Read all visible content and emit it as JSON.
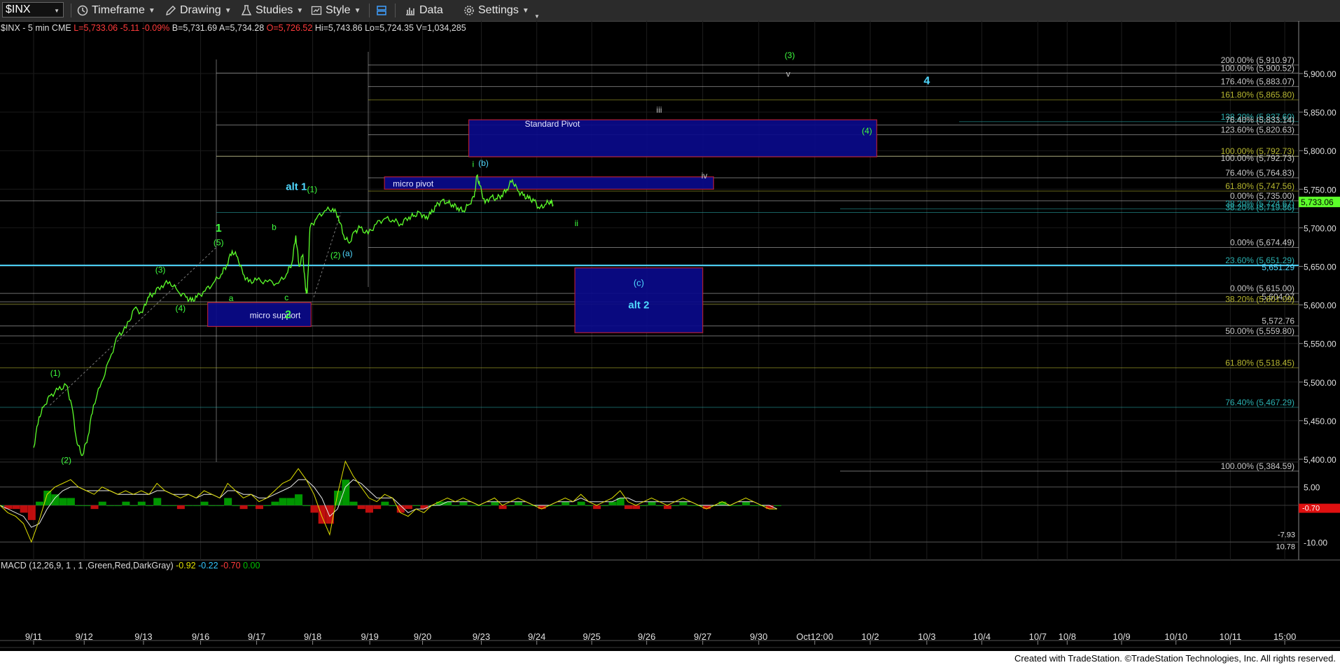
{
  "toolbar": {
    "symbol": "$INX",
    "timeframe": "Timeframe",
    "drawing": "Drawing",
    "studies": "Studies",
    "style": "Style",
    "data": "Data",
    "settings": "Settings"
  },
  "info": {
    "symbol_desc": "$INX - 5 min  CME",
    "last": "L=5,733.06",
    "chg": "-5.11",
    "pct": "-0.09%",
    "bid": "B=5,731.69",
    "ask": "A=5,734.28",
    "open": "O=5,726.52",
    "hi": "Hi=5,743.86",
    "lo": "Lo=5,724.35",
    "vol": "V=1,034,285"
  },
  "macd_info": {
    "name": "MACD (12,26,9, 1 , 1 ,Green,Red,DarkGray)",
    "macd": "-0.92",
    "signal": "-0.22",
    "hist": "-0.70",
    "zero": "0.00"
  },
  "footer": "Created with TradeStation. ©TradeStation Technologies, Inc. All rights reserved.",
  "colors": {
    "price_line": "#5cff2a",
    "accent_cyan": "#4fd8ff",
    "box_fill": "#0a0a8a",
    "box_border": "#c0203a",
    "label_green": "#3fff3f"
  },
  "chart_data": [
    {
      "type": "line",
      "symbol": "$INX",
      "interval": "5 min",
      "ylim": [
        5360,
        5945
      ],
      "y_ticks": [
        5400,
        5450,
        5500,
        5550,
        5600,
        5650,
        5700,
        5750,
        5800,
        5850,
        5900
      ],
      "y_tick_labels": [
        "5,400.00",
        "5,450.00",
        "5,500.00",
        "5,550.00",
        "5,600.00",
        "5,650.00",
        "5,700.00",
        "5,750.00",
        "5,800.00",
        "5,850.00",
        "5,900.00"
      ],
      "x_labels": [
        "9/11",
        "9/12",
        "9/13",
        "9/16",
        "9/17",
        "9/18",
        "9/19",
        "9/20",
        "9/23",
        "9/24",
        "9/25",
        "9/26",
        "9/27",
        "9/30",
        "Oct12:00",
        "10/2",
        "10/3",
        "10/4",
        "10/7",
        "10/8",
        "10/9",
        "10/10",
        "10/11",
        "15:00"
      ],
      "last_price": 5733.06,
      "last_price_label": "5,733.06",
      "series": [
        {
          "name": "$INX",
          "points": [
            [
              0.0,
              5415
            ],
            [
              0.1,
              5455
            ],
            [
              0.2,
              5470
            ],
            [
              0.3,
              5482
            ],
            [
              0.45,
              5490
            ],
            [
              0.6,
              5496
            ],
            [
              0.7,
              5470
            ],
            [
              0.8,
              5420
            ],
            [
              0.9,
              5405
            ],
            [
              1.0,
              5430
            ],
            [
              1.1,
              5470
            ],
            [
              1.25,
              5500
            ],
            [
              1.4,
              5530
            ],
            [
              1.55,
              5560
            ],
            [
              1.7,
              5570
            ],
            [
              1.85,
              5595
            ],
            [
              2.0,
              5590
            ],
            [
              2.1,
              5610
            ],
            [
              2.2,
              5615
            ],
            [
              2.35,
              5625
            ],
            [
              2.5,
              5630
            ],
            [
              2.65,
              5618
            ],
            [
              2.8,
              5610
            ],
            [
              2.9,
              5605
            ],
            [
              3.0,
              5610
            ],
            [
              3.15,
              5618
            ],
            [
              3.3,
              5628
            ],
            [
              3.45,
              5640
            ],
            [
              3.55,
              5652
            ],
            [
              3.65,
              5670
            ],
            [
              3.75,
              5662
            ],
            [
              3.85,
              5640
            ],
            [
              3.95,
              5630
            ],
            [
              4.1,
              5632
            ],
            [
              4.3,
              5630
            ],
            [
              4.5,
              5628
            ],
            [
              4.65,
              5640
            ],
            [
              4.75,
              5655
            ],
            [
              4.82,
              5690
            ],
            [
              4.88,
              5650
            ],
            [
              4.95,
              5665
            ],
            [
              5.0,
              5620
            ],
            [
              5.03,
              5615
            ],
            [
              5.08,
              5700
            ],
            [
              5.2,
              5712
            ],
            [
              5.35,
              5722
            ],
            [
              5.5,
              5725
            ],
            [
              5.6,
              5715
            ],
            [
              5.7,
              5690
            ],
            [
              5.8,
              5680
            ],
            [
              5.9,
              5695
            ],
            [
              6.0,
              5700
            ],
            [
              6.15,
              5692
            ],
            [
              6.3,
              5705
            ],
            [
              6.45,
              5712
            ],
            [
              6.6,
              5710
            ],
            [
              6.75,
              5705
            ],
            [
              6.9,
              5714
            ],
            [
              7.0,
              5716
            ],
            [
              7.1,
              5720
            ],
            [
              7.2,
              5712
            ],
            [
              7.3,
              5718
            ],
            [
              7.4,
              5728
            ],
            [
              7.5,
              5735
            ],
            [
              7.6,
              5733
            ],
            [
              7.7,
              5730
            ],
            [
              7.8,
              5726
            ],
            [
              7.9,
              5722
            ],
            [
              8.0,
              5730
            ],
            [
              8.1,
              5740
            ],
            [
              8.15,
              5768
            ],
            [
              8.2,
              5755
            ],
            [
              8.3,
              5732
            ],
            [
              8.4,
              5740
            ],
            [
              8.5,
              5738
            ],
            [
              8.6,
              5742
            ],
            [
              8.7,
              5750
            ],
            [
              8.8,
              5762
            ],
            [
              8.9,
              5748
            ],
            [
              9.0,
              5742
            ],
            [
              9.1,
              5738
            ],
            [
              9.2,
              5735
            ],
            [
              9.3,
              5725
            ],
            [
              9.4,
              5730
            ],
            [
              9.5,
              5735
            ],
            [
              9.55,
              5730
            ]
          ]
        }
      ],
      "fib_lines": [
        {
          "label": "200.00% (5,910.97)",
          "value": 5910.97,
          "color": "#c8c8c8"
        },
        {
          "label": "100.00% (5,900.52)",
          "value": 5900.52,
          "color": "#c8c8c8"
        },
        {
          "label": "176.40% (5,883.07)",
          "value": 5883.07,
          "color": "#c8c8c8"
        },
        {
          "label": "161.80% (5,865.80)",
          "value": 5865.8,
          "color": "#b8b830"
        },
        {
          "label": "138.20% (5,837.60)",
          "value": 5837.6,
          "color": "#2ab0b0"
        },
        {
          "label": "76.40% (5,833.14)",
          "value": 5833.14,
          "color": "#c8c8c8"
        },
        {
          "label": "123.60% (5,820.63)",
          "value": 5820.63,
          "color": "#c8c8c8"
        },
        {
          "label": "100.00% (5,792.73)",
          "value": 5792.73,
          "color": "#b8b830"
        },
        {
          "label": "100.00% (5,792.73)",
          "value": 5792.73,
          "color": "#c8c8c8"
        },
        {
          "label": "76.40% (5,764.83)",
          "value": 5764.83,
          "color": "#c8c8c8"
        },
        {
          "label": "61.80% (5,747.56)",
          "value": 5747.56,
          "color": "#b8b830"
        },
        {
          "label": "0.00% (5,735.00)",
          "value": 5735.0,
          "color": "#c8c8c8"
        },
        {
          "label": "38.20% (5,724.67)",
          "value": 5724.67,
          "color": "#2ab0b0"
        },
        {
          "label": "38.20% (5,719.86)",
          "value": 5719.86,
          "color": "#2ab0b0"
        },
        {
          "label": "0.00% (5,674.49)",
          "value": 5674.49,
          "color": "#c8c8c8"
        },
        {
          "label": "23.60% (5,651.29)",
          "value": 5651.29,
          "color": "#2ab0b0"
        },
        {
          "label": "5,651.29",
          "value": 5651.29,
          "color": "#4fd8ff"
        },
        {
          "label": "0.00% (5,615.00)",
          "value": 5615.0,
          "color": "#c8c8c8"
        },
        {
          "label": "5,604.07",
          "value": 5604.07,
          "color": "#c8c8c8"
        },
        {
          "label": "38.20% (5,601.09)",
          "value": 5601.09,
          "color": "#b8b830"
        },
        {
          "label": "5,572.76",
          "value": 5572.76,
          "color": "#c8c8c8"
        },
        {
          "label": "50.00% (5,559.80)",
          "value": 5559.8,
          "color": "#c8c8c8"
        },
        {
          "label": "61.80% (5,518.45)",
          "value": 5518.45,
          "color": "#b8b830"
        },
        {
          "label": "76.40% (5,467.29)",
          "value": 5467.29,
          "color": "#2ab0b0"
        },
        {
          "label": "100.00% (5,384.59)",
          "value": 5384.59,
          "color": "#c8c8c8"
        }
      ],
      "zones": [
        {
          "label": "Standard Pivot",
          "x": [
            8.0,
            15.5
          ],
          "y": [
            5792,
            5840
          ]
        },
        {
          "label": "micro pivot",
          "x": [
            6.45,
            12.5
          ],
          "y": [
            5750,
            5766
          ]
        },
        {
          "label": "micro support",
          "x": [
            3.2,
            5.1
          ],
          "y": [
            5572,
            5603
          ]
        },
        {
          "label": "(c)",
          "label2": "alt 2",
          "x": [
            9.95,
            12.3
          ],
          "y": [
            5564,
            5648
          ]
        }
      ],
      "annotations": [
        {
          "text": "(1)",
          "x": 0.4,
          "y": 5508,
          "color": "#3fff3f"
        },
        {
          "text": "(2)",
          "x": 0.6,
          "y": 5395,
          "color": "#3fff3f"
        },
        {
          "text": "(3)",
          "x": 2.33,
          "y": 5642,
          "color": "#3fff3f"
        },
        {
          "text": "(4)",
          "x": 2.7,
          "y": 5592,
          "color": "#3fff3f"
        },
        {
          "text": "1",
          "x": 3.4,
          "y": 5695,
          "color": "#3fff3f"
        },
        {
          "text": "(5)",
          "x": 3.4,
          "y": 5677,
          "color": "#3fff3f"
        },
        {
          "text": "a",
          "x": 3.63,
          "y": 5605,
          "color": "#3fff3f"
        },
        {
          "text": "b",
          "x": 4.42,
          "y": 5697,
          "color": "#3fff3f"
        },
        {
          "text": "c",
          "x": 4.65,
          "y": 5606,
          "color": "#3fff3f"
        },
        {
          "text": "2",
          "x": 4.68,
          "y": 5583,
          "color": "#3fff3f"
        },
        {
          "text": "alt 1",
          "x": 4.83,
          "y": 5749,
          "color": "#4fd8ff"
        },
        {
          "text": "(1)",
          "x": 5.12,
          "y": 5746,
          "color": "#3fff3f"
        },
        {
          "text": "(2)",
          "x": 5.55,
          "y": 5661,
          "color": "#3fff3f"
        },
        {
          "text": "(a)",
          "x": 5.77,
          "y": 5663,
          "color": "#4fd8ff"
        },
        {
          "text": "i",
          "x": 8.08,
          "y": 5779,
          "color": "#3fff3f"
        },
        {
          "text": "(b)",
          "x": 8.27,
          "y": 5780,
          "color": "#4fd8ff"
        },
        {
          "text": "ii",
          "x": 9.98,
          "y": 5702,
          "color": "#3fff3f"
        },
        {
          "text": "iii",
          "x": 11.5,
          "y": 5849,
          "color": "#c8c8c8"
        },
        {
          "text": "iv",
          "x": 12.33,
          "y": 5764,
          "color": "#c8c8c8"
        },
        {
          "text": "(3)",
          "x": 13.9,
          "y": 5920,
          "color": "#3fff3f"
        },
        {
          "text": "v",
          "x": 13.87,
          "y": 5896,
          "color": "#c8c8c8"
        },
        {
          "text": "(4)",
          "x": 15.32,
          "y": 5822,
          "color": "#3fff3f"
        },
        {
          "text": "4",
          "x": 16.42,
          "y": 5886,
          "color": "#4fd8ff"
        }
      ]
    },
    {
      "type": "line",
      "title": "MACD (12,26,9, 1 , 1 ,Green,Red,DarkGray)",
      "ylim": [
        -13,
        8
      ],
      "y_ticks": [
        5,
        -10
      ],
      "y_tick_labels": [
        "5.00",
        "-10.00"
      ],
      "right_labels": [
        "-7.93",
        "-0.70",
        "10.78"
      ],
      "series": [
        {
          "name": "MACD",
          "values": [
            0,
            -2,
            -3,
            -5,
            -10,
            -4,
            3,
            5,
            6,
            7,
            5,
            4,
            3,
            5,
            4,
            3,
            4,
            3,
            4,
            3,
            6,
            4,
            3,
            2,
            3,
            2,
            4,
            3,
            2,
            6,
            4,
            2,
            3,
            1,
            2,
            4,
            6,
            7,
            10,
            7,
            3,
            -3,
            -8,
            3,
            12,
            8,
            5,
            2,
            1,
            3,
            2,
            -2,
            -3,
            -1,
            -2,
            0,
            1,
            2,
            1,
            2,
            1,
            0,
            1,
            2,
            0,
            1,
            2,
            1,
            0,
            -1,
            0,
            1,
            2,
            1,
            3,
            1,
            0,
            1,
            2,
            4,
            1,
            0,
            1,
            2,
            1,
            0,
            1,
            2,
            1,
            0,
            -1,
            0,
            1,
            0,
            1,
            2,
            1,
            0,
            -1,
            -1
          ]
        },
        {
          "name": "Signal",
          "values": [
            0,
            -1,
            -2,
            -3,
            -6,
            -5,
            -1,
            2,
            4,
            5,
            5,
            4,
            4,
            4,
            4,
            3,
            3,
            3,
            3,
            3,
            4,
            4,
            3,
            3,
            3,
            2,
            3,
            3,
            2,
            4,
            4,
            3,
            3,
            2,
            2,
            3,
            4,
            5,
            7,
            7,
            5,
            2,
            -3,
            -1,
            5,
            7,
            6,
            4,
            2,
            2,
            2,
            0,
            -2,
            -1,
            -1,
            0,
            0,
            1,
            1,
            1,
            1,
            0,
            1,
            1,
            1,
            1,
            1,
            1,
            0,
            0,
            0,
            1,
            1,
            1,
            2,
            1,
            1,
            1,
            1,
            2,
            2,
            1,
            1,
            1,
            1,
            1,
            1,
            1,
            1,
            0,
            0,
            0,
            0,
            0,
            1,
            1,
            1,
            0,
            0,
            -1
          ]
        }
      ]
    }
  ]
}
